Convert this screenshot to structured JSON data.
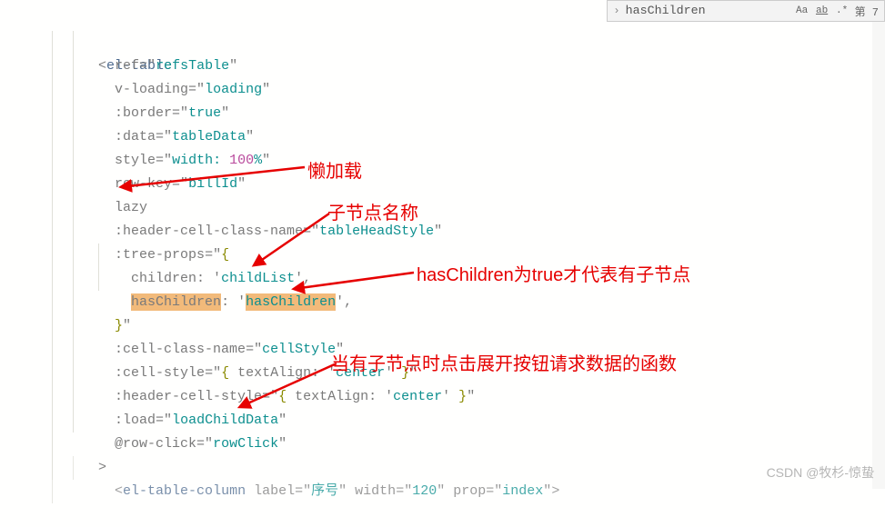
{
  "search": {
    "query": "hasChildren",
    "options": {
      "case": "Aa",
      "wholeWord": "ab",
      "regex": ".*"
    },
    "resultLabel": "第 7"
  },
  "code": {
    "tagOpen": "<el-table",
    "attrs": {
      "ref": {
        "name": "ref",
        "val": "refsTable"
      },
      "vloading": {
        "name": "v-loading",
        "val": "loading"
      },
      "border": {
        "name": ":border",
        "val": "true"
      },
      "data": {
        "name": ":data",
        "val": "tableData"
      },
      "style": {
        "name": "style",
        "valPrefix": "width: ",
        "valNum": "100",
        "valSuffix": "%"
      },
      "rowkey": {
        "name": "row-key",
        "val": "billId"
      },
      "lazy": {
        "name": "lazy"
      },
      "headerCellClass": {
        "name": ":header-cell-class-name",
        "val": "tableHeadStyle"
      },
      "treeProps": {
        "name": ":tree-props",
        "children": "children",
        "childrenVal": "childList",
        "hasChildren": "hasChildren",
        "hasChildrenVal": "hasChildren"
      },
      "cellClass": {
        "name": ":cell-class-name",
        "val": "cellStyle"
      },
      "cellStyle": {
        "name": ":cell-style",
        "key": "textAlign",
        "val": "center"
      },
      "headerCellStyle": {
        "name": ":header-cell-style",
        "key": "textAlign",
        "val": "center"
      },
      "load": {
        "name": ":load",
        "val": "loadChildData"
      },
      "rowClick": {
        "name": "@row-click",
        "val": "rowClick"
      }
    },
    "closeAngle": ">",
    "childTag": "<el-table-column",
    "childAttrs": {
      "label": "序号",
      "width": "120",
      "prop": "index"
    }
  },
  "annotations": {
    "lazy": "懒加载",
    "childName": "子节点名称",
    "hasChildren": "hasChildren为true才代表有子节点",
    "loadFn": "当有子节点时点击展开按钮请求数据的函数"
  },
  "watermark": "CSDN @牧杉-惊蛰"
}
